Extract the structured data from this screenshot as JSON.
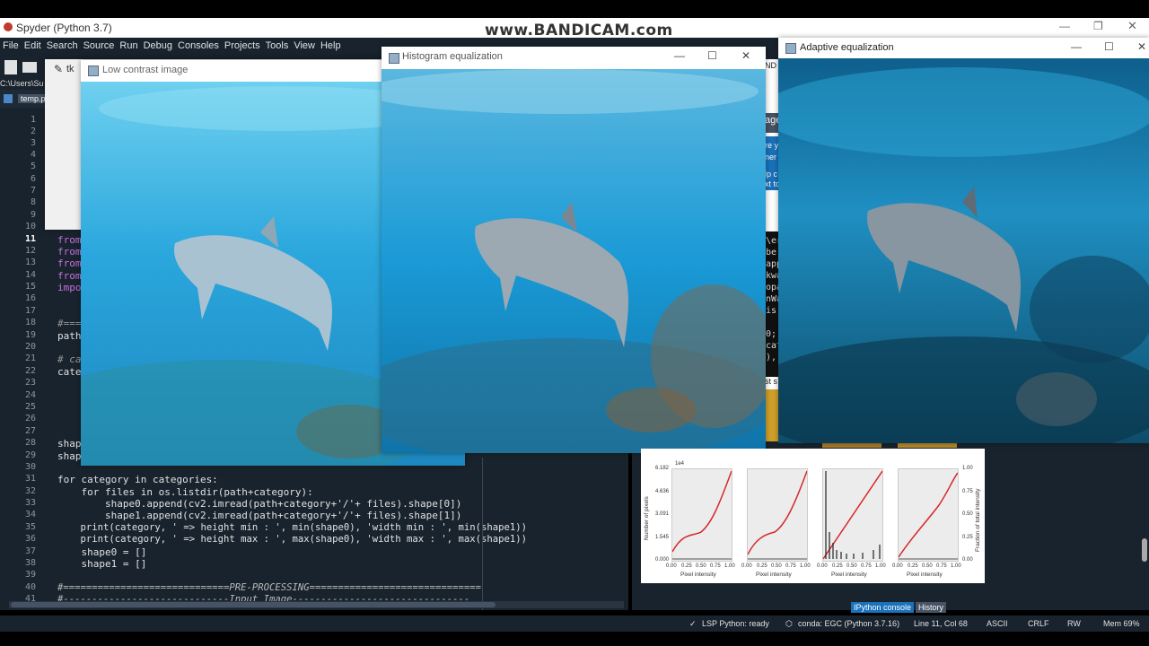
{
  "app": {
    "title": "Spyder (Python 3.7)",
    "watermark": "www.BANDICAM.com",
    "menu": [
      "File",
      "Edit",
      "Search",
      "Source",
      "Run",
      "Debug",
      "Consoles",
      "Projects",
      "Tools",
      "View",
      "Help"
    ],
    "path_fragment": "C:\\Users\\Su",
    "file_tab": "temp.p"
  },
  "editor": {
    "line_numbers": [
      "1",
      "2",
      "3",
      "4",
      "5",
      "6",
      "7",
      "8",
      "9",
      "10",
      "11",
      "12",
      "13",
      "14",
      "15",
      "16",
      "17",
      "18",
      "19",
      "20",
      "21",
      "22",
      "23",
      "24",
      "25",
      "26",
      "27",
      "28",
      "29",
      "30",
      "31",
      "32",
      "33",
      "34",
      "35",
      "36",
      "37",
      "38",
      "39",
      "40",
      "41"
    ],
    "current_line": "11",
    "partial_lines": {
      "l11": "from",
      "l12": "from",
      "l13": "from",
      "l14": "from",
      "l15": "impo",
      "l18": "#===",
      "l19": "path",
      "l21": "# ca",
      "l22": "categ",
      "l28": "shape",
      "l29": "shape"
    },
    "code_lines": [
      {
        "n": "31",
        "text": "for category in categories:"
      },
      {
        "n": "32",
        "text": "    for files in os.listdir(path+category):"
      },
      {
        "n": "33",
        "text": "        shape0.append(cv2.imread(path+category+'/'+ files).shape[0])"
      },
      {
        "n": "34",
        "text": "        shape1.append(cv2.imread(path+category+'/'+ files).shape[1])"
      },
      {
        "n": "35",
        "text": "    print(category, ' => height min : ', min(shape0), 'width min : ', min(shape1))"
      },
      {
        "n": "36",
        "text": "    print(category, ' => height max : ', max(shape0), 'width max : ', max(shape1))"
      },
      {
        "n": "37",
        "text": "    shape0 = []"
      },
      {
        "n": "38",
        "text": "    shape1 = []"
      },
      {
        "n": "40",
        "text": "#=============================PRE-PROCESSING=============================="
      },
      {
        "n": "41",
        "text": "#-----------------------------Input Image-------------------------------"
      }
    ]
  },
  "right_fragments": {
    "r1": "ND (",
    "r2": "age",
    "r3": "re y",
    "r4": "ner",
    "r5": "lp c",
    "r6": "xt to",
    "r7": "\\er",
    "r8": "be",
    "r9": "app",
    "r10": "kwa",
    "r11": "opa",
    "r12": "nWa",
    "r13": "is",
    "r14": "0;",
    "r15": "cat",
    "r16": "),",
    "r17": "st s"
  },
  "windows": {
    "tk": {
      "title": "tk"
    },
    "low_contrast": {
      "title": "Low contrast image"
    },
    "hist_eq": {
      "title": "Histogram equalization"
    },
    "adaptive": {
      "title": "Adaptive equalization"
    }
  },
  "plot_panel": {
    "exponent": "1e4",
    "y_ticks": [
      "6.182",
      "4.636",
      "3.091",
      "1.545",
      "0.000"
    ],
    "y_label": "Number of pixels",
    "x_ticks": [
      "0.00",
      "0.25",
      "0.50",
      "0.75",
      "1.00"
    ],
    "x_label": "Pixel intensity",
    "right_ticks": [
      "1.00",
      "0.75",
      "0.50",
      "0.25",
      "0.00"
    ],
    "right_label": "Fraction of total intensity"
  },
  "console_tabs": {
    "ipython": "IPython console",
    "history": "History"
  },
  "status": {
    "lsp": "LSP Python: ready",
    "conda": "conda: EGC (Python 3.7.16)",
    "position": "Line 11, Col 68",
    "encoding": "ASCII",
    "eol": "CRLF",
    "rw": "RW",
    "mem": "Mem 69%"
  },
  "colors": {
    "spyder_bg": "#19232d",
    "accent": "#1a72bb",
    "plot_red": "#d62728"
  }
}
